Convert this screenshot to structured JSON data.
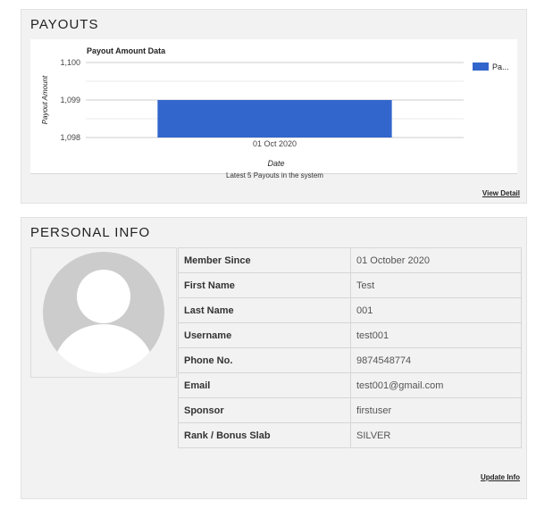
{
  "payouts": {
    "title": "PAYOUTS",
    "caption": "Latest 5 Payouts in the system",
    "view_detail": "View Detail"
  },
  "chart_data": {
    "type": "bar",
    "title": "Payout Amount Data",
    "xlabel": "Date",
    "ylabel": "Payout Amount",
    "categories": [
      "01 Oct 2020"
    ],
    "series": [
      {
        "name": "Pa...",
        "values": [
          1099
        ]
      }
    ],
    "ylim": [
      1098,
      1100
    ],
    "yticks": [
      "1,098",
      "1,099",
      "1,100"
    ],
    "grid": true,
    "legend": "right",
    "color": "#3366cc"
  },
  "personal": {
    "title": "PERSONAL INFO",
    "update_info": "Update Info",
    "rows": [
      {
        "label": "Member Since",
        "value": "01 October 2020"
      },
      {
        "label": "First Name",
        "value": "Test"
      },
      {
        "label": "Last Name",
        "value": "001"
      },
      {
        "label": "Username",
        "value": "test001"
      },
      {
        "label": "Phone No.",
        "value": "9874548774"
      },
      {
        "label": "Email",
        "value": "test001@gmail.com"
      },
      {
        "label": "Sponsor",
        "value": "firstuser"
      },
      {
        "label": "Rank / Bonus Slab",
        "value": "SILVER"
      }
    ]
  }
}
